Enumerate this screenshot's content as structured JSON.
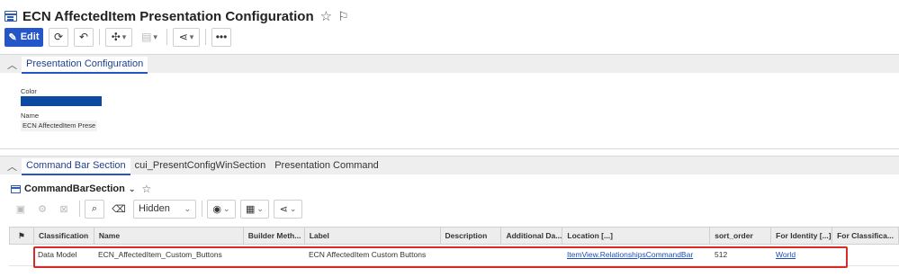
{
  "header": {
    "title": "ECN AffectedItem Presentation Configuration",
    "accent": "#2456c8"
  },
  "toolbar": {
    "edit_label": "Edit",
    "icons": [
      "refresh-icon",
      "undo-redo-icon",
      "network-icon",
      "clipboard-icon",
      "share-icon",
      "more-icon"
    ]
  },
  "presentation": {
    "tab_label": "Presentation Configuration",
    "color_label": "Color",
    "color_value": "#0b4aa0",
    "name_label": "Name",
    "name_value": "ECN AffectedItem Prese"
  },
  "command": {
    "tabs": [
      "Command Bar Section",
      "cui_PresentConfigWinSection",
      "Presentation Command"
    ],
    "section_title": "CommandBarSection",
    "view_select": "Hidden"
  },
  "grid": {
    "columns": [
      "Classification",
      "Name",
      "Builder Meth...",
      "Label",
      "Description",
      "Additional Da...",
      "Location [...]",
      "sort_order",
      "For Identity [...]",
      "For Classifica..."
    ],
    "rows": [
      {
        "classification": "Data Model",
        "name": "ECN_AffectedItem_Custom_Buttons",
        "builder": "",
        "label": "ECN AffectedItem Custom Buttons",
        "description": "",
        "additional": "",
        "location": "ItemView.RelationshipsCommandBar",
        "sort_order": "512",
        "identity": "World",
        "classification2": ""
      }
    ]
  },
  "highlight_color": "#d92a2a"
}
